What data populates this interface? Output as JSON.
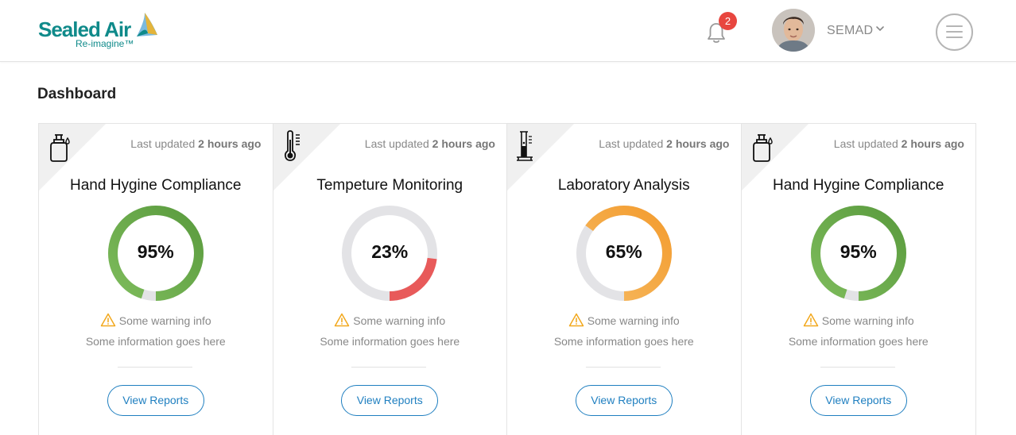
{
  "header": {
    "logo_text": "Sealed Air",
    "logo_tagline": "Re-imagine™",
    "notifications_count": "2",
    "username": "SEMAD"
  },
  "page": {
    "title": "Dashboard"
  },
  "cards": [
    {
      "icon": "soap-dispenser-icon",
      "updated_prefix": "Last updated",
      "updated_time": "2 hours ago",
      "title": "Hand Hygine Compliance",
      "value": 95,
      "value_label": "95%",
      "color": "#5a9b3e",
      "color_end": "#7dbb5b",
      "warning": "Some warning info",
      "info": "Some information goes here",
      "button": "View Reports"
    },
    {
      "icon": "thermometer-icon",
      "updated_prefix": "Last updated",
      "updated_time": "2 hours ago",
      "title": "Tempeture Monitoring",
      "value": 23,
      "value_label": "23%",
      "color": "#e85a5a",
      "color_end": "#e85a5a",
      "warning": "Some warning info",
      "info": "Some information goes here",
      "button": "View Reports"
    },
    {
      "icon": "test-tube-icon",
      "updated_prefix": "Last updated",
      "updated_time": "2 hours ago",
      "title": "Laboratory Analysis",
      "value": 65,
      "value_label": "65%",
      "color": "#f39c2f",
      "color_end": "#f6b960",
      "warning": "Some warning info",
      "info": "Some information goes here",
      "button": "View Reports"
    },
    {
      "icon": "soap-dispenser-icon",
      "updated_prefix": "Last updated",
      "updated_time": "2 hours ago",
      "title": "Hand Hygine Compliance",
      "value": 95,
      "value_label": "95%",
      "color": "#5a9b3e",
      "color_end": "#7dbb5b",
      "warning": "Some warning info",
      "info": "Some information goes here",
      "button": "View Reports"
    }
  ],
  "colors": {
    "track": "#e3e3e6",
    "accent": "#1f7fc0",
    "badge": "#e8463f",
    "warning": "#f2a81d"
  }
}
